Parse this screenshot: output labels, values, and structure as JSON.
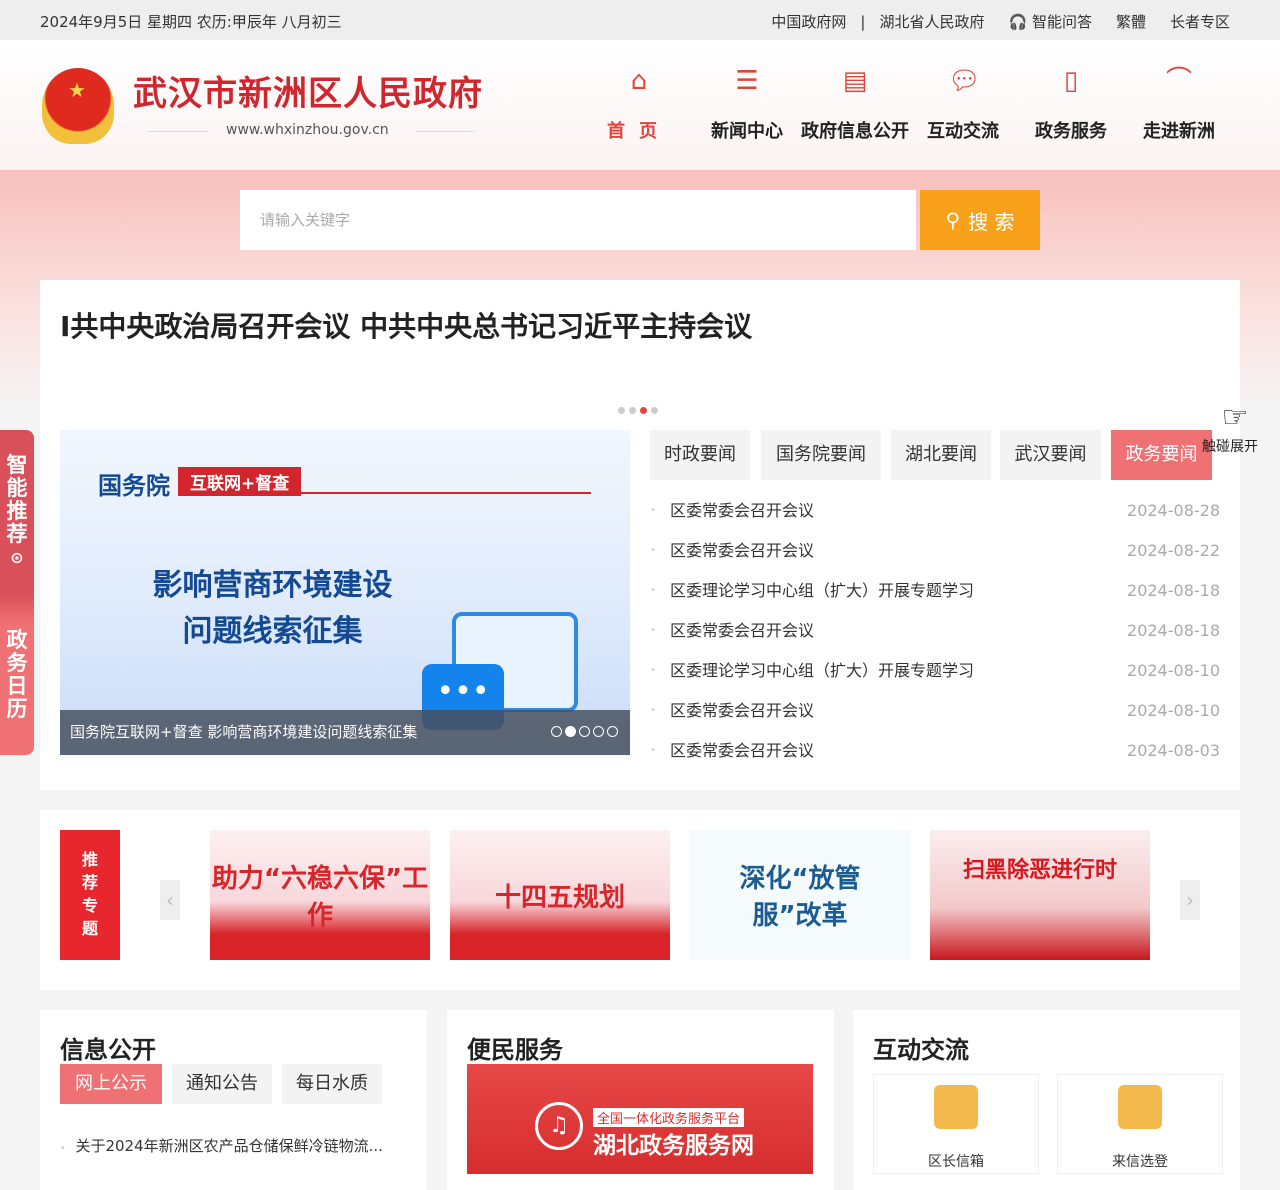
{
  "topbar": {
    "date": "2024年9月5日 星期四  农历:甲辰年 八月初三",
    "links": [
      "中国政府网",
      "|",
      "湖北省人民政府"
    ],
    "ai_qa": "智能问答",
    "traditional": "繁體",
    "elderly": "长者专区"
  },
  "header": {
    "site_name": "武汉市新洲区人民政府",
    "url": "www.whxinzhou.gov.cn"
  },
  "nav": [
    {
      "label": "首页",
      "icon": "home-icon"
    },
    {
      "label": "新闻中心",
      "icon": "document-icon"
    },
    {
      "label": "政府信息公开",
      "icon": "scroll-icon"
    },
    {
      "label": "互动交流",
      "icon": "chat-icon"
    },
    {
      "label": "政务服务",
      "icon": "bookmark-icon"
    },
    {
      "label": "走进新洲",
      "icon": "landmark-icon"
    }
  ],
  "search": {
    "placeholder": "请输入关键字",
    "button": "搜 索"
  },
  "headline": "I共中央政治局召开会议 中共中央总书记习近平主持会议",
  "slide": {
    "org": "国务院",
    "tag": "互联网+督查",
    "line1": "影响营商环境建设",
    "line2": "问题线索征集",
    "caption": "国务院互联网+督查 影响营商环境建设问题线索征集"
  },
  "news_tabs": [
    "时政要闻",
    "国务院要闻",
    "湖北要闻",
    "武汉要闻",
    "政务要闻"
  ],
  "touch": "触碰展开",
  "news": [
    {
      "title": "区委常委会召开会议",
      "date": "2024-08-28"
    },
    {
      "title": "区委常委会召开会议",
      "date": "2024-08-22"
    },
    {
      "title": "区委理论学习中心组（扩大）开展专题学习",
      "date": "2024-08-18"
    },
    {
      "title": "区委常委会召开会议",
      "date": "2024-08-18"
    },
    {
      "title": "区委理论学习中心组（扩大）开展专题学习",
      "date": "2024-08-10"
    },
    {
      "title": "区委常委会召开会议",
      "date": "2024-08-10"
    },
    {
      "title": "区委常委会召开会议",
      "date": "2024-08-03"
    }
  ],
  "side": {
    "a": "智能推荐",
    "b": "政务日历"
  },
  "topics": {
    "label": "推荐专题",
    "items": [
      "助力“六稳六保”工作",
      "十四五规划",
      "深化“放管服”改革",
      "扫黑除恶进行时"
    ]
  },
  "info": {
    "title": "信息公开",
    "tabs": [
      "网上公示",
      "通知公告",
      "每日水质"
    ],
    "item": "关于2024年新洲区农产品仓储保鲜冷链物流..."
  },
  "service": {
    "title": "便民服务",
    "banner_small": "全国一体化政务服务平台",
    "banner_big": "湖北政务服务网"
  },
  "interact": {
    "title": "互动交流",
    "items": [
      "区长信箱",
      "来信选登"
    ]
  }
}
